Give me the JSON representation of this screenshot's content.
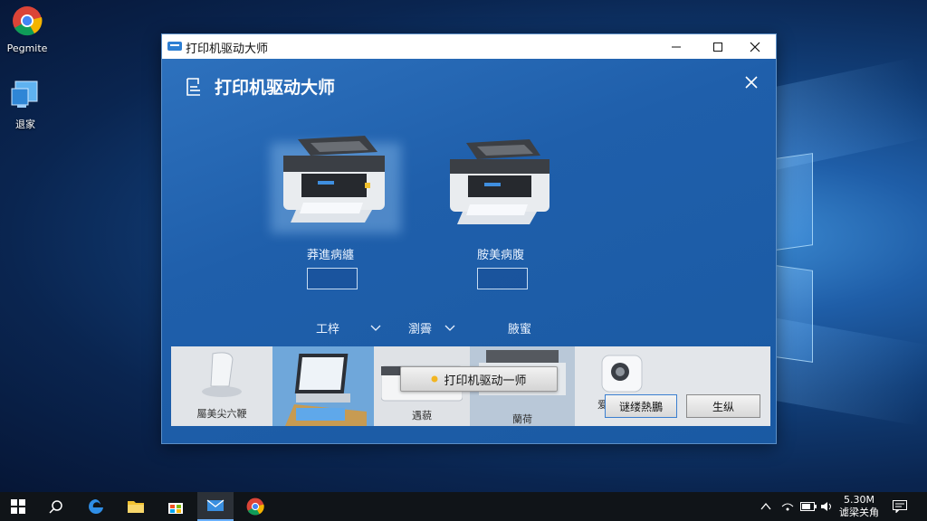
{
  "desktop": {
    "icons": [
      {
        "label": "Pegmite",
        "icon": "chrome-icon"
      },
      {
        "label": "退家",
        "icon": "computer-icon"
      }
    ]
  },
  "window": {
    "title": "打印机驱动大师",
    "app_title": "打印机驱动大师",
    "printers": [
      {
        "label": "莽進病纏"
      },
      {
        "label": "胺美病腹"
      }
    ],
    "dropdowns": [
      {
        "label": "工梓"
      },
      {
        "label": "瀏霽"
      }
    ],
    "static_label": "腋蜜",
    "strip": {
      "tiles": [
        {
          "label": "屬美尖六鞭"
        },
        {
          "label": ""
        },
        {
          "label": "遇藐"
        },
        {
          "label": "蘭荷"
        },
        {
          "label": "爱遥"
        }
      ],
      "popup_button": "打印机驱动一师",
      "primary_button": "谜缕熱鵬",
      "secondary_button": "生纵"
    }
  },
  "taskbar": {
    "apps": [
      "start-icon",
      "search-icon",
      "edge-icon",
      "explorer-icon",
      "store-icon",
      "mail-icon",
      "chrome-icon"
    ],
    "clock_time": "5.30M",
    "clock_date": "谑梁关角"
  },
  "colors": {
    "accent": "#1f5fab",
    "titlebar": "#ffffff",
    "taskbar": "#101418"
  }
}
